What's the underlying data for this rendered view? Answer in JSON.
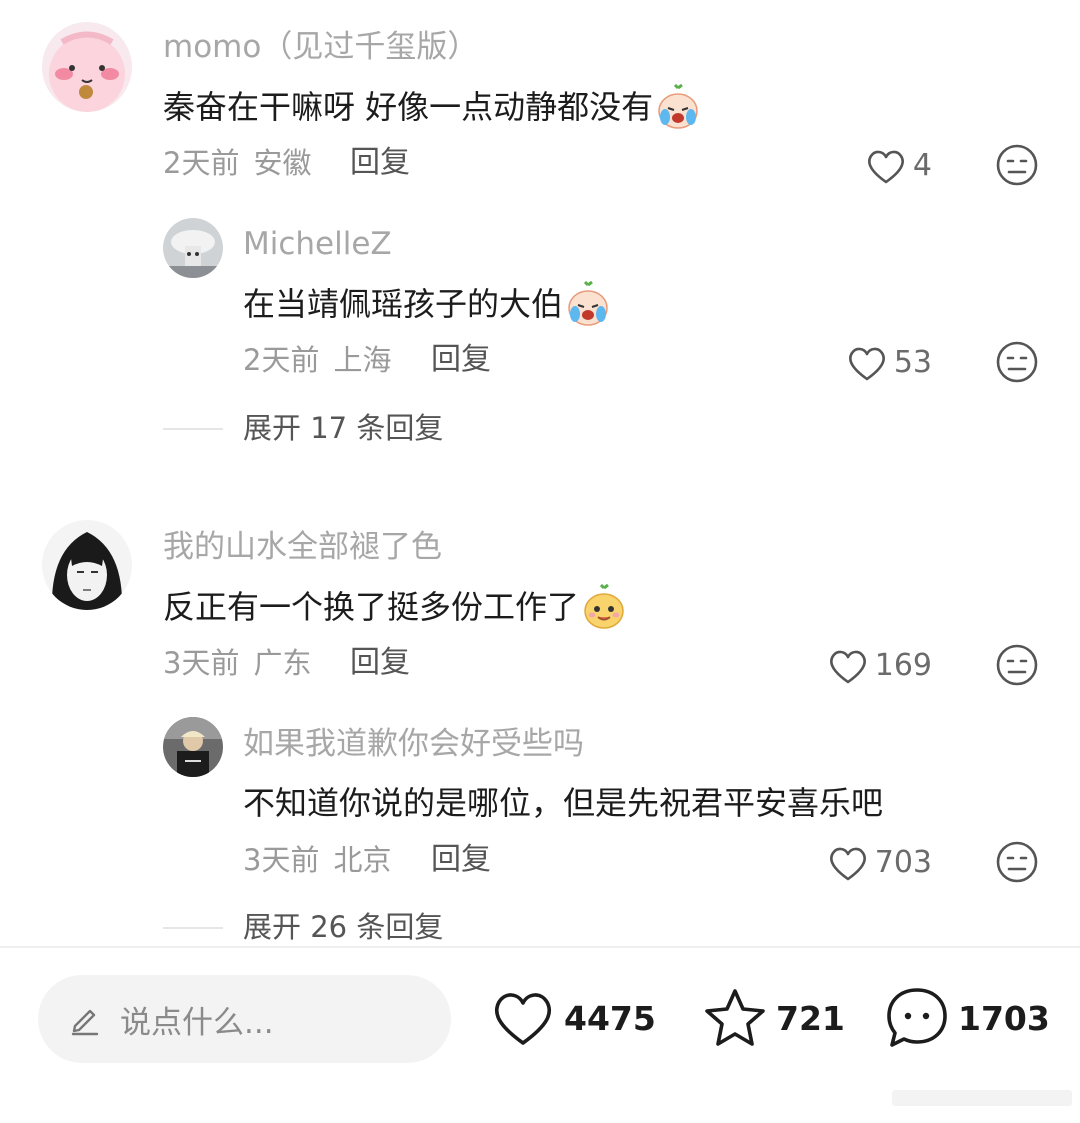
{
  "comments": [
    {
      "username": "momo（见过千玺版）",
      "text": "秦奋在干嘛呀 好像一点动静都没有",
      "emoji": "crying-face-emoji",
      "time": "2天前",
      "location": "安徽",
      "reply_label": "回复",
      "likes": "4",
      "replies": [
        {
          "username": "MichelleZ",
          "text": "在当靖佩瑶孩子的大伯",
          "emoji": "crying-face-emoji",
          "time": "2天前",
          "location": "上海",
          "reply_label": "回复",
          "likes": "53"
        }
      ],
      "expand_label": "展开 17 条回复"
    },
    {
      "username": "我的山水全部褪了色",
      "text": "反正有一个换了挺多份工作了",
      "emoji": "smirk-face-emoji",
      "time": "3天前",
      "location": "广东",
      "reply_label": "回复",
      "likes": "169",
      "replies": [
        {
          "username": "如果我道歉你会好受些吗",
          "text": "不知道你说的是哪位，但是先祝君平安喜乐吧",
          "time": "3天前",
          "location": "北京",
          "reply_label": "回复",
          "likes": "703"
        }
      ],
      "expand_label": "展开 26 条回复"
    }
  ],
  "bottom_bar": {
    "input_placeholder": "说点什么...",
    "like_count": "4475",
    "favorite_count": "721",
    "comment_count": "1703"
  },
  "colors": {
    "meta_gray": "#9a9a9a",
    "name_gray": "#a7a7a7",
    "text_dark": "#1c1c1c",
    "input_bg": "#f3f3f3"
  },
  "icons": {
    "like": "heart-outline-icon",
    "dislike": "neutral-face-icon",
    "favorite": "star-outline-icon",
    "comment": "speech-bubble-icon",
    "edit": "pencil-icon"
  }
}
